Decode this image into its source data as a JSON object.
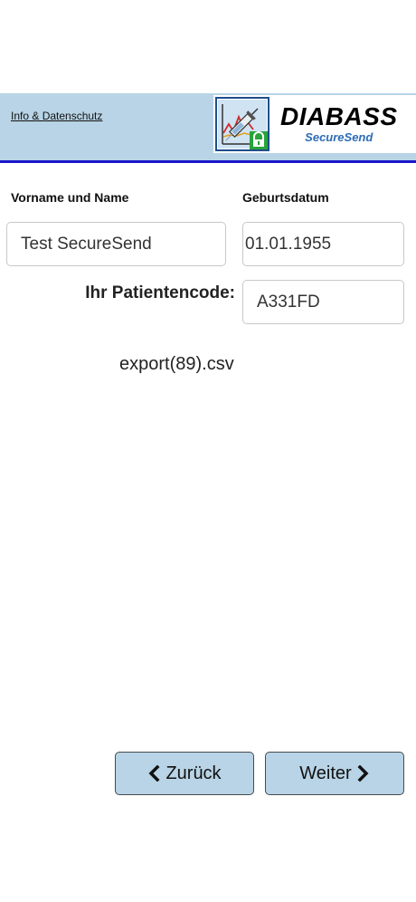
{
  "header": {
    "info_link": "Info & Datenschutz",
    "logo_title": "DIABASS",
    "logo_subtitle": "SecureSend",
    "background_color": "#b8d4e6",
    "border_color": "#1a17c9"
  },
  "form": {
    "name_label": "Vorname und Name",
    "name_value": "Test SecureSend",
    "birthdate_label": "Geburtsdatum",
    "birthdate_value": "01.01.1955",
    "patient_code_label": "Ihr Patientencode:",
    "patient_code_value": "A331FD"
  },
  "file": {
    "name": "export(89).csv"
  },
  "navigation": {
    "back_label": "Zurück",
    "back_icon": "chevron-left-icon",
    "next_label": "Weiter",
    "next_icon": "chevron-right-icon"
  }
}
